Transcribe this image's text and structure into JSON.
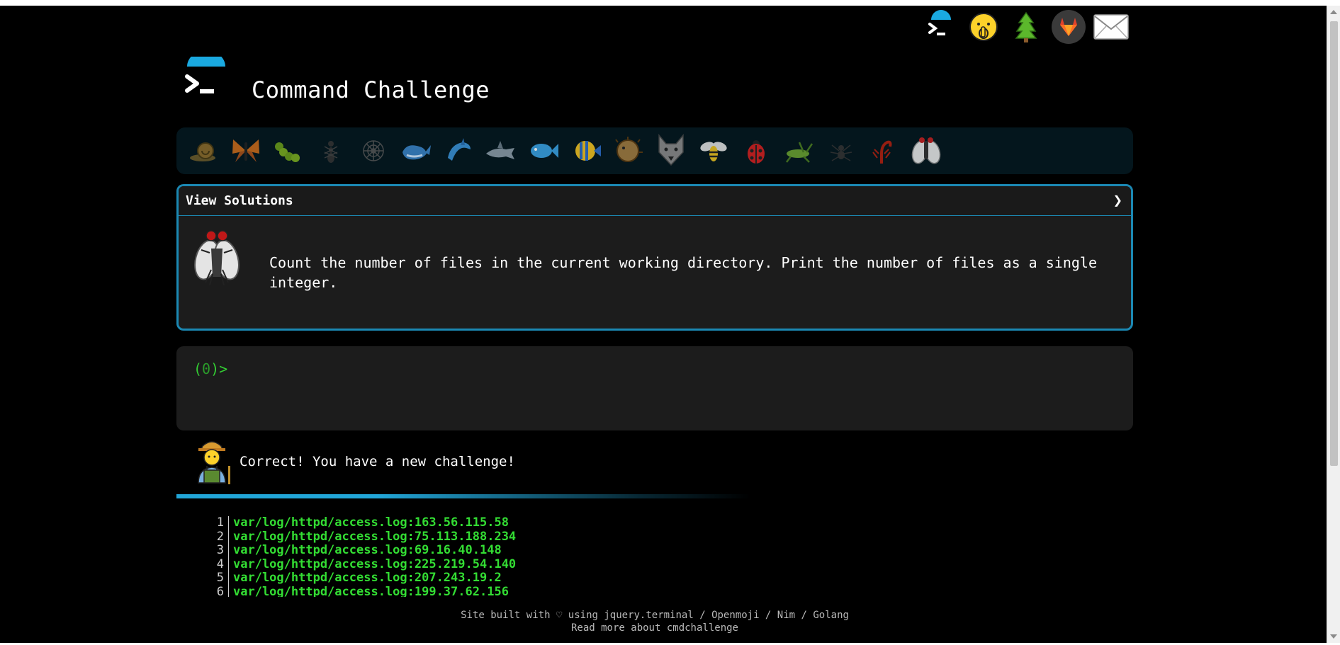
{
  "header": {
    "title": "Command Challenge"
  },
  "top_icons": [
    "terminal-logo-icon",
    "shushing-face-icon",
    "tree-icon",
    "gitlab-icon",
    "mail-icon"
  ],
  "critters": [
    "snail-icon",
    "butterfly-icon",
    "caterpillar-icon",
    "ant-icon",
    "spider-web-icon",
    "whale-icon",
    "dolphin-icon",
    "shark-icon",
    "fish-icon",
    "tropical-fish-icon",
    "blowfish-icon",
    "wolf-icon",
    "bee-icon",
    "ladybug-icon",
    "cricket-icon",
    "spider-icon",
    "scorpion-icon",
    "fly-icon"
  ],
  "panel": {
    "header_label": "View Solutions",
    "challenge_text": "Count the number of files in the current working directory. Print the number of files as a single integer."
  },
  "terminal": {
    "prompt_open": "(",
    "prompt_count": "0",
    "prompt_close": ")>"
  },
  "result": {
    "message": "Correct! You have a new challenge!"
  },
  "output": [
    {
      "n": "1",
      "text": "var/log/httpd/access.log:163.56.115.58"
    },
    {
      "n": "2",
      "text": "var/log/httpd/access.log:75.113.188.234"
    },
    {
      "n": "3",
      "text": "var/log/httpd/access.log:69.16.40.148"
    },
    {
      "n": "4",
      "text": "var/log/httpd/access.log:225.219.54.140"
    },
    {
      "n": "5",
      "text": "var/log/httpd/access.log:207.243.19.2"
    },
    {
      "n": "6",
      "text": "var/log/httpd/access.log:199.37.62.156"
    }
  ],
  "footer": {
    "line1": "Site built with ♡ using jquery.terminal / Openmoji / Nim / Golang",
    "line2": "Read more about cmdchallenge"
  },
  "colors": {
    "accent": "#1b88b3",
    "prompt": "#33cc33",
    "output": "#33dd33",
    "panel": "#1c1c1c"
  }
}
